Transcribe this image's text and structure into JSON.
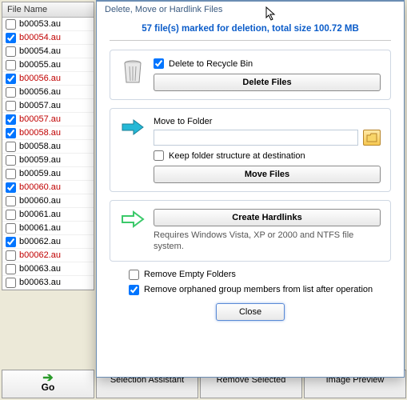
{
  "file_list": {
    "header": "File Name",
    "items": [
      {
        "name": "b00053.au",
        "checked": false,
        "dup": false
      },
      {
        "name": "b00054.au",
        "checked": true,
        "dup": true
      },
      {
        "name": "b00054.au",
        "checked": false,
        "dup": false
      },
      {
        "name": "b00055.au",
        "checked": false,
        "dup": false
      },
      {
        "name": "b00056.au",
        "checked": true,
        "dup": true
      },
      {
        "name": "b00056.au",
        "checked": false,
        "dup": false
      },
      {
        "name": "b00057.au",
        "checked": false,
        "dup": false
      },
      {
        "name": "b00057.au",
        "checked": true,
        "dup": true
      },
      {
        "name": "b00058.au",
        "checked": true,
        "dup": true
      },
      {
        "name": "b00058.au",
        "checked": false,
        "dup": false
      },
      {
        "name": "b00059.au",
        "checked": false,
        "dup": false
      },
      {
        "name": "b00059.au",
        "checked": false,
        "dup": false
      },
      {
        "name": "b00060.au",
        "checked": true,
        "dup": true
      },
      {
        "name": "b00060.au",
        "checked": false,
        "dup": false
      },
      {
        "name": "b00061.au",
        "checked": false,
        "dup": false
      },
      {
        "name": "b00061.au",
        "checked": false,
        "dup": false
      },
      {
        "name": "b00062.au",
        "checked": true,
        "dup": false
      },
      {
        "name": "b00062.au",
        "checked": false,
        "dup": true
      },
      {
        "name": "b00063.au",
        "checked": false,
        "dup": false
      },
      {
        "name": "b00063.au",
        "checked": false,
        "dup": false
      }
    ]
  },
  "bottom": {
    "go": "Go",
    "selection_assistant": "Selection Assistant",
    "remove_selected": "Remove Selected",
    "image_preview": "Image Preview"
  },
  "dialog": {
    "title": "Delete, Move or Hardlink Files",
    "summary": "57 file(s) marked for deletion, total size 100.72 MB",
    "delete": {
      "recycle_label": "Delete to Recycle Bin",
      "recycle_checked": true,
      "button": "Delete Files"
    },
    "move": {
      "label": "Move to Folder",
      "path": "",
      "keep_label": "Keep folder structure at destination",
      "keep_checked": false,
      "button": "Move Files"
    },
    "hardlink": {
      "button": "Create Hardlinks",
      "note": "Requires Windows Vista, XP or 2000 and NTFS file system."
    },
    "footer": {
      "remove_empty_label": "Remove Empty Folders",
      "remove_empty_checked": false,
      "remove_orphaned_label": "Remove orphaned group members from list after operation",
      "remove_orphaned_checked": true
    },
    "close": "Close"
  }
}
